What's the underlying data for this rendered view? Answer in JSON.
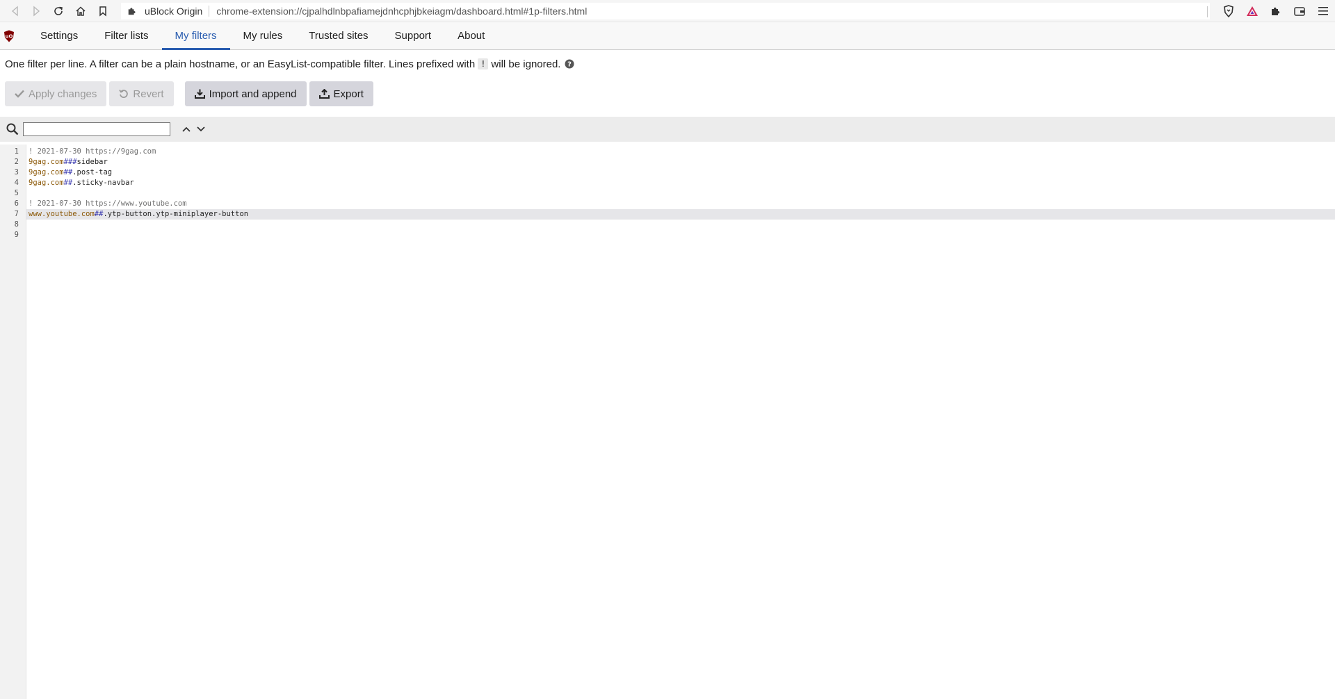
{
  "browser": {
    "extension_name": "uBlock Origin",
    "url": "chrome-extension://cjpalhdlnbpafiamejdnhcphjbkeiagm/dashboard.html#1p-filters.html"
  },
  "tabs": [
    {
      "label": "Settings",
      "active": false
    },
    {
      "label": "Filter lists",
      "active": false
    },
    {
      "label": "My filters",
      "active": true
    },
    {
      "label": "My rules",
      "active": false
    },
    {
      "label": "Trusted sites",
      "active": false
    },
    {
      "label": "Support",
      "active": false
    },
    {
      "label": "About",
      "active": false
    }
  ],
  "description": {
    "before": "One filter per line. A filter can be a plain hostname, or an EasyList-compatible filter. Lines prefixed with",
    "code": "!",
    "after": "will be ignored."
  },
  "buttons": {
    "apply": "Apply changes",
    "revert": "Revert",
    "import": "Import and append",
    "export": "Export"
  },
  "search": {
    "value": ""
  },
  "editor": {
    "line_numbers": [
      "1",
      "2",
      "3",
      "4",
      "5",
      "6",
      "7",
      "8",
      "9"
    ],
    "lines": [
      {
        "comment": "! 2021-07-30 https://9gag.com",
        "host": "",
        "sep": "",
        "sel": ""
      },
      {
        "comment": "",
        "host": "9gag.com",
        "sep": "###",
        "sel": "sidebar"
      },
      {
        "comment": "",
        "host": "9gag.com",
        "sep": "##",
        "sel": ".post-tag"
      },
      {
        "comment": "",
        "host": "9gag.com",
        "sep": "##",
        "sel": ".sticky-navbar"
      },
      {
        "comment": "",
        "host": "",
        "sep": "",
        "sel": ""
      },
      {
        "comment": "! 2021-07-30 https://www.youtube.com",
        "host": "",
        "sep": "",
        "sel": ""
      },
      {
        "comment": "",
        "host": "www.youtube.com",
        "sep": "##",
        "sel": ".ytp-button.ytp-miniplayer-button"
      },
      {
        "comment": "",
        "host": "",
        "sep": "",
        "sel": ""
      },
      {
        "comment": "",
        "host": "",
        "sep": "",
        "sel": ""
      }
    ],
    "active_line": 7
  }
}
